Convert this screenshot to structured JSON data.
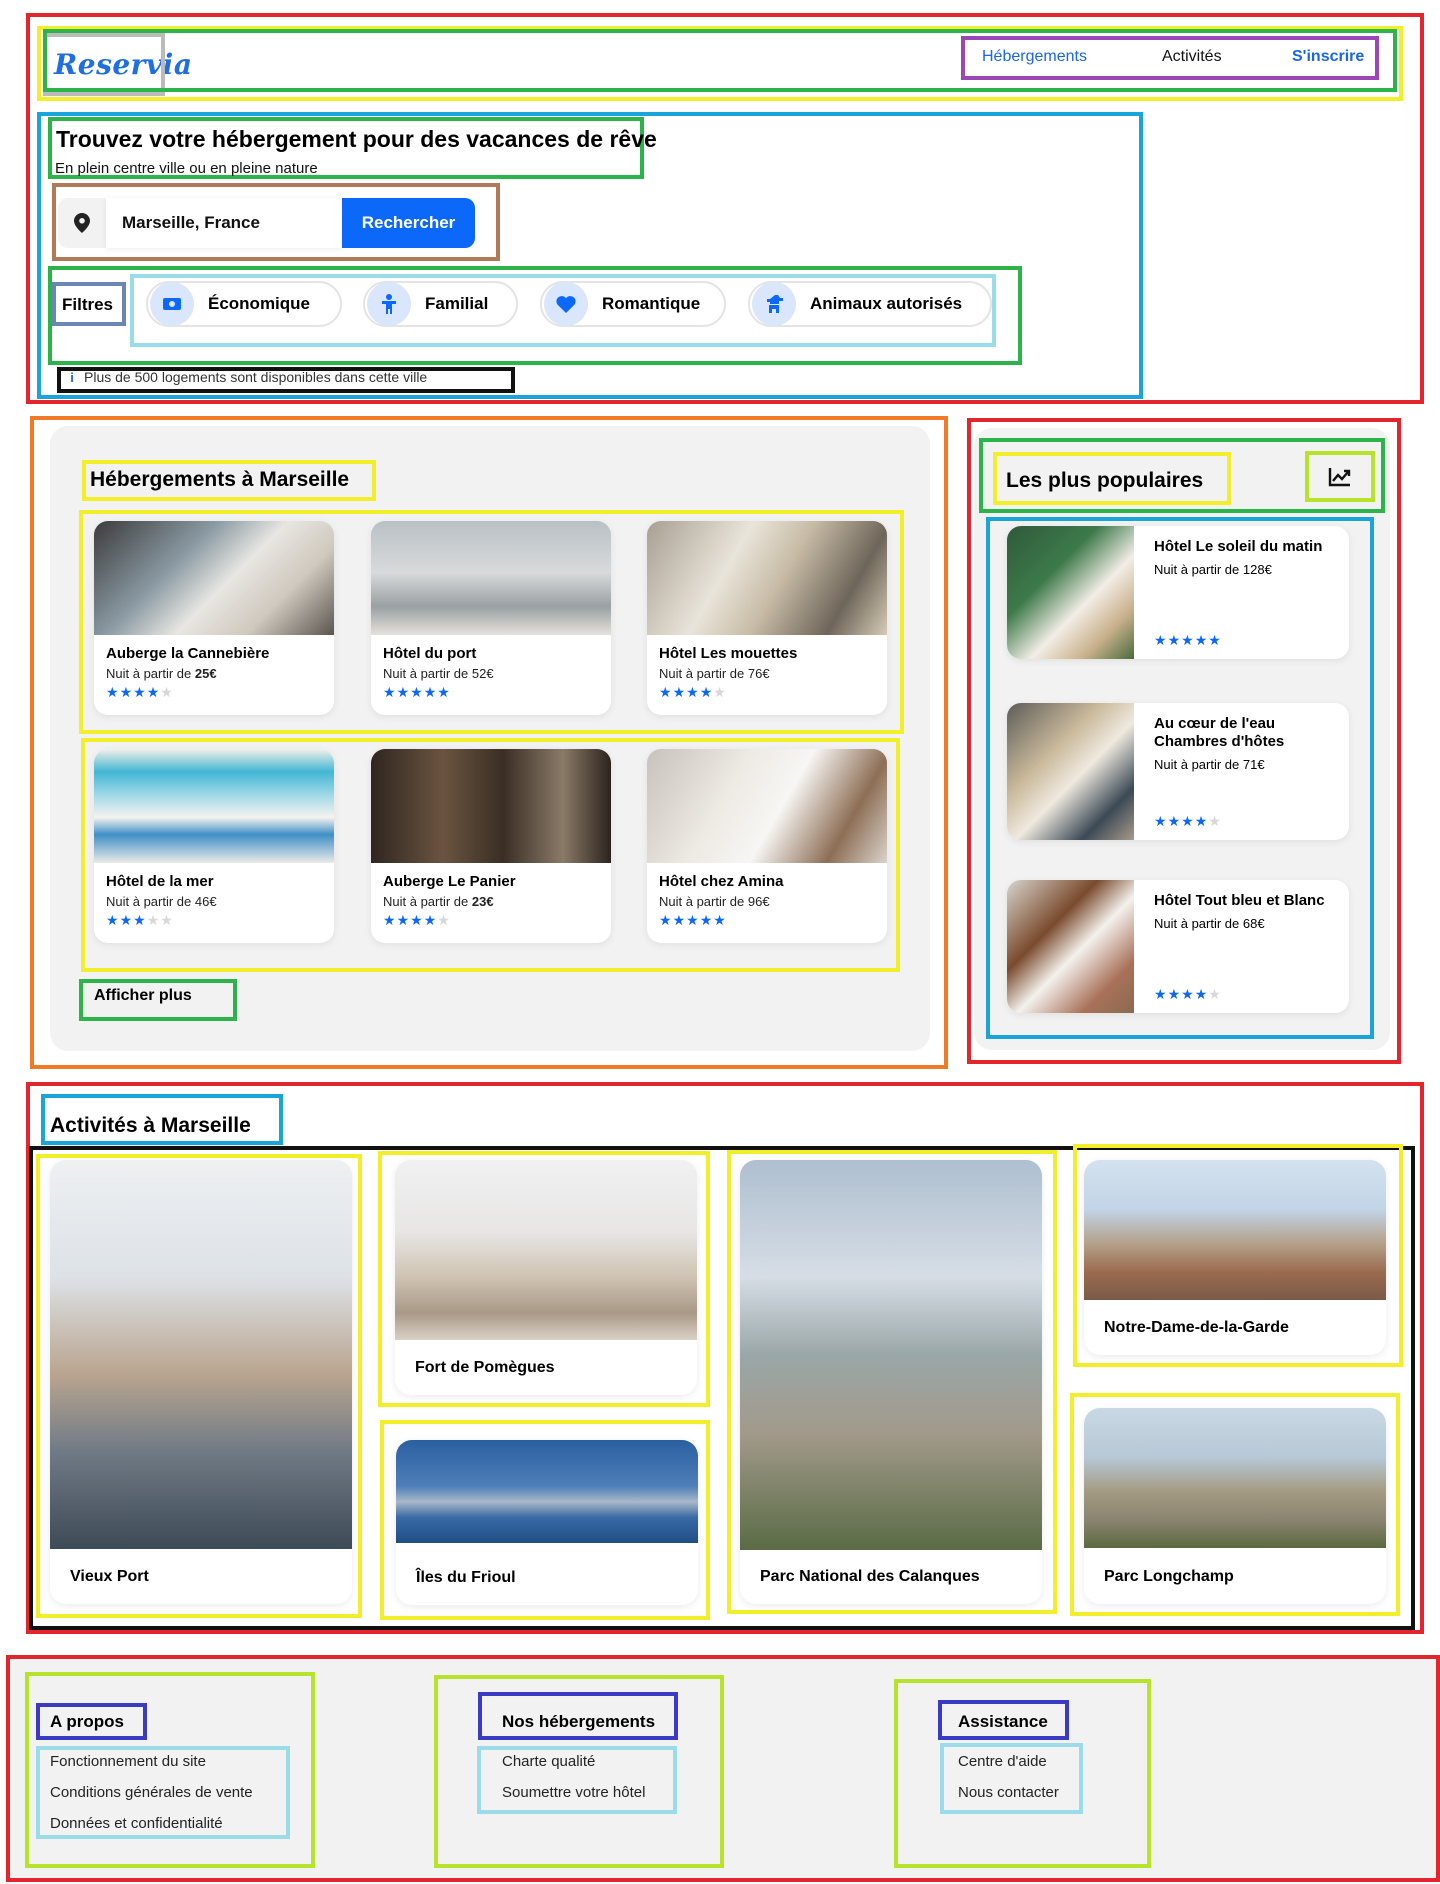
{
  "header": {
    "logo": "Reservia",
    "nav": [
      {
        "label": "Hébergements"
      },
      {
        "label": "Activités"
      },
      {
        "label": "S'inscrire"
      }
    ]
  },
  "hero": {
    "title": "Trouvez votre hébergement pour des vacances de rêve",
    "subtitle": "En plein centre ville ou en pleine nature",
    "search_value": "Marseille, France",
    "search_button": "Rechercher",
    "filters_label": "Filtres",
    "filters": [
      {
        "label": "Économique",
        "icon": "money-icon"
      },
      {
        "label": "Familial",
        "icon": "child-icon"
      },
      {
        "label": "Romantique",
        "icon": "heart-icon"
      },
      {
        "label": "Animaux autorisés",
        "icon": "dog-icon"
      }
    ],
    "info": "Plus de 500 logements sont disponibles dans cette ville"
  },
  "accommodations": {
    "title": "Hébergements à Marseille",
    "price_prefix": "Nuit à partir de",
    "items": [
      {
        "name": "Auberge la Cannebière",
        "price": "25€",
        "rating": 4
      },
      {
        "name": "Hôtel du port",
        "price": "52€",
        "rating": 5
      },
      {
        "name": "Hôtel Les mouettes",
        "price": "76€",
        "rating": 4
      },
      {
        "name": "Hôtel de la mer",
        "price": "46€",
        "rating": 3
      },
      {
        "name": "Auberge Le Panier",
        "price": "23€",
        "rating": 4
      },
      {
        "name": "Hôtel chez Amina",
        "price": "96€",
        "rating": 5
      }
    ],
    "show_more": "Afficher plus"
  },
  "popular": {
    "title": "Les plus populaires",
    "icon": "trending-up-icon",
    "items": [
      {
        "name": "Hôtel Le soleil du matin",
        "price_text": "Nuit à partir de 128€",
        "rating": 5
      },
      {
        "name": "Au cœur de l'eau Chambres d'hôtes",
        "price_text": "Nuit à partir de 71€",
        "rating": 4
      },
      {
        "name": "Hôtel Tout bleu et Blanc",
        "price_text": "Nuit à partir de 68€",
        "rating": 4
      }
    ]
  },
  "activities": {
    "title": "Activités à Marseille",
    "items": [
      {
        "name": "Vieux Port"
      },
      {
        "name": "Fort de Pomègues"
      },
      {
        "name": "Îles du Frioul"
      },
      {
        "name": "Parc National des Calanques"
      },
      {
        "name": "Notre-Dame-de-la-Garde"
      },
      {
        "name": "Parc Longchamp"
      }
    ]
  },
  "footer": {
    "columns": [
      {
        "title": "A propos",
        "links": [
          "Fonctionnement du site",
          "Conditions générales de vente",
          "Données et confidentialité"
        ]
      },
      {
        "title": "Nos hébergements",
        "links": [
          "Charte qualité",
          "Soumettre votre hôtel"
        ]
      },
      {
        "title": "Assistance",
        "links": [
          "Centre d'aide",
          "Nous contacter"
        ]
      }
    ]
  },
  "colors": {
    "accent": "#0B68F8",
    "panel_bg": "#F2F2F2",
    "chip_icon_bg": "#D9E6FB"
  }
}
